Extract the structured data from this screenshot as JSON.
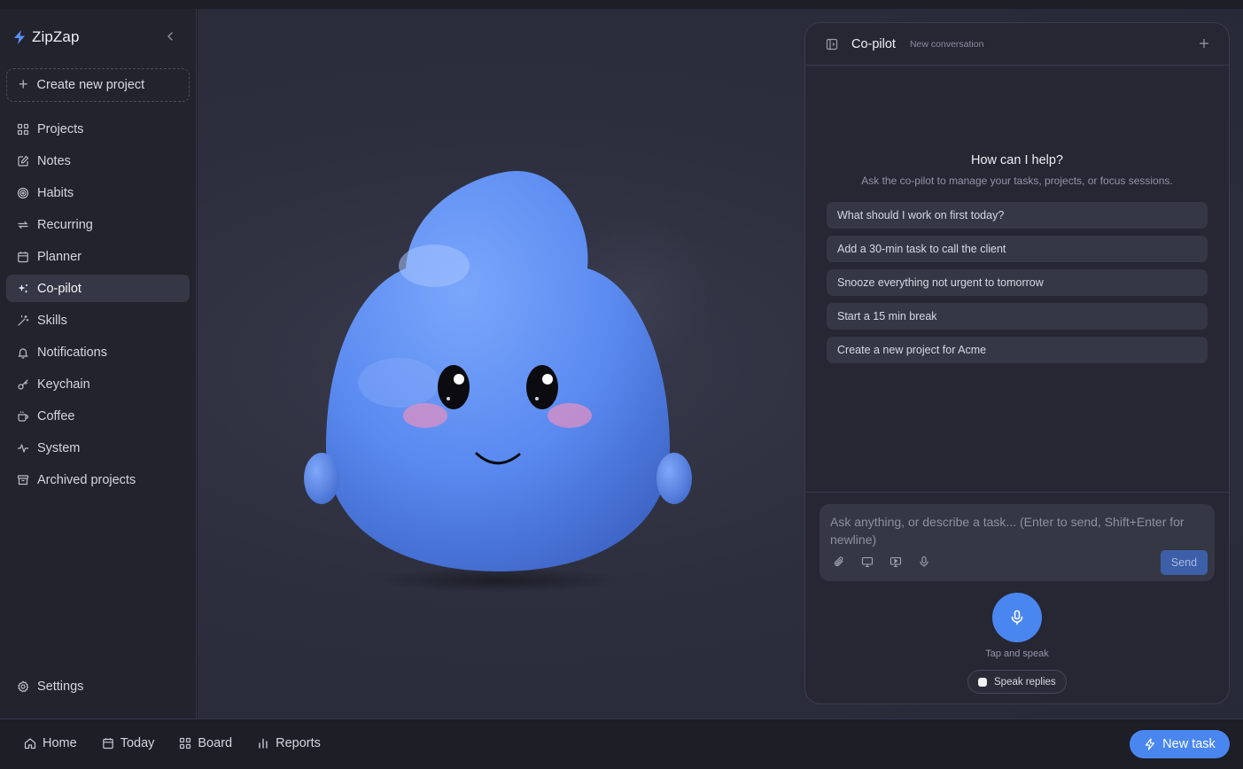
{
  "app": {
    "name": "ZipZap"
  },
  "sidebar": {
    "new_project_label": "Create new project",
    "items": [
      {
        "label": "Projects",
        "icon": "grid-icon"
      },
      {
        "label": "Notes",
        "icon": "note-edit-icon"
      },
      {
        "label": "Habits",
        "icon": "target-icon"
      },
      {
        "label": "Recurring",
        "icon": "repeat-icon"
      },
      {
        "label": "Planner",
        "icon": "calendar-icon"
      },
      {
        "label": "Co-pilot",
        "icon": "sparkles-icon",
        "active": true
      },
      {
        "label": "Skills",
        "icon": "wand-icon"
      },
      {
        "label": "Notifications",
        "icon": "bell-icon"
      },
      {
        "label": "Keychain",
        "icon": "key-icon"
      },
      {
        "label": "Coffee",
        "icon": "coffee-icon"
      },
      {
        "label": "System",
        "icon": "activity-icon"
      },
      {
        "label": "Archived projects",
        "icon": "archive-icon"
      }
    ],
    "settings_label": "Settings"
  },
  "copilot": {
    "title": "Co-pilot",
    "subtitle": "New conversation",
    "help_title": "How can I help?",
    "help_subtitle": "Ask the co-pilot to manage your tasks, projects, or focus sessions.",
    "suggestions": [
      "What should I work on first today?",
      "Add a 30-min task to call the client",
      "Snooze everything not urgent to tomorrow",
      "Start a 15 min break",
      "Create a new project for Acme"
    ],
    "input_placeholder": "Ask anything, or describe a task... (Enter to send, Shift+Enter for newline)",
    "send_label": "Send",
    "mic_label": "Tap and speak",
    "speak_replies_label": "Speak replies"
  },
  "bottom_nav": {
    "items": [
      {
        "label": "Home",
        "icon": "home-icon"
      },
      {
        "label": "Today",
        "icon": "calendar-icon"
      },
      {
        "label": "Board",
        "icon": "grid-icon"
      },
      {
        "label": "Reports",
        "icon": "bar-chart-icon"
      }
    ],
    "new_task_label": "New task"
  },
  "colors": {
    "accent": "#4a86f0",
    "mascot": "#5b8cf2"
  }
}
